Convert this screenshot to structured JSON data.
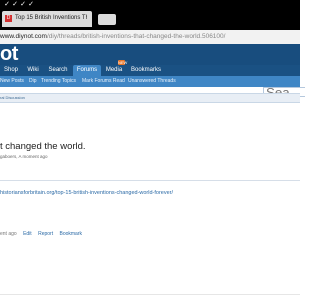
{
  "status_bar": {
    "icons": [
      "check-icon",
      "check-icon",
      "check-icon",
      "check-icon"
    ],
    "check_glyph": "✓"
  },
  "browser": {
    "tab": {
      "title": "Top 15 British Inventions Th",
      "favicon_letter": "D"
    },
    "url_host": "www.diynot.com",
    "url_path": "/diy/threads/british-inventions-that-changed-the-world.506100/"
  },
  "site": {
    "logo": "ot",
    "nav": [
      "Shop",
      "Wiki",
      "Search",
      "Forums",
      "Media",
      "Bookmarks"
    ],
    "active_nav": "Forums",
    "media_badge": "NEW",
    "subnav": [
      "New Posts",
      "Dip",
      "Trending Topics",
      "Mark Forums Read",
      "Unanswered Threads"
    ],
    "search_placeholder": "Sea"
  },
  "breadcrumb": "ral Discussion",
  "thread": {
    "title": "t changed the world.",
    "meta": "gaboers, A moment ago"
  },
  "post": {
    "link": "historiansforbritain.org/top-15-british-inventions-changed-world-forever/",
    "age": "ent ago",
    "actions": [
      "Edit",
      "Report",
      "Bookmark"
    ]
  },
  "colors": {
    "header": "#184d7e",
    "nav_active": "#3f86c5",
    "badge": "#e8762a",
    "link": "#2b6aa6"
  }
}
